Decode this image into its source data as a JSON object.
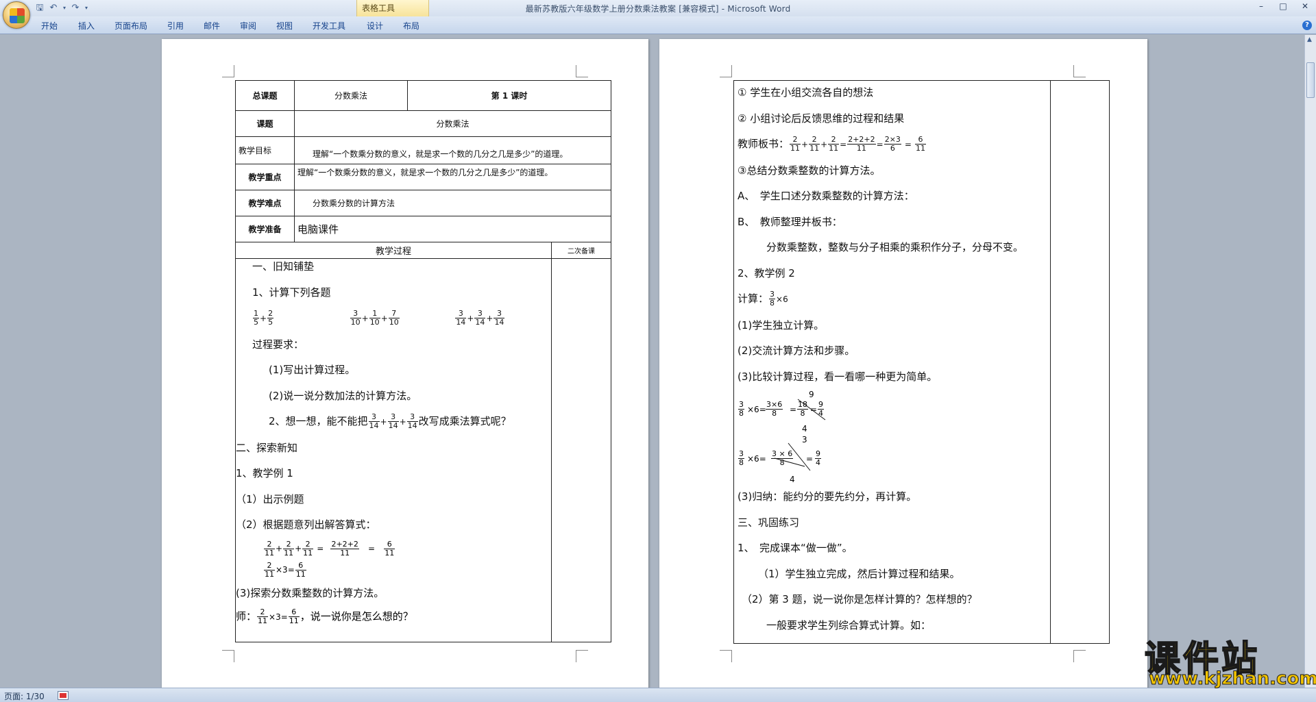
{
  "window": {
    "title": "最新苏教版六年级数学上册分数乘法教案 [兼容模式] - Microsoft Word",
    "context_tab_group": "表格工具"
  },
  "ribbon": {
    "tabs": [
      "开始",
      "插入",
      "页面布局",
      "引用",
      "邮件",
      "审阅",
      "视图",
      "开发工具",
      "设计",
      "布局"
    ]
  },
  "status": {
    "page": "页面: 1/30"
  },
  "left_page": {
    "header": {
      "general_topic_label": "总课题",
      "general_topic": "分数乘法",
      "period": "第 1 课时",
      "topic_label": "课题",
      "topic": "分数乘法",
      "goal_label": "教学目标",
      "goal": "理解“一个数乘分数的意义，就是求一个数的几分之几是多少”的道理。",
      "key_label": "教学重点",
      "key": "理解“一个数乘分数的意义，就是求一个数的几分之几是多少”的道理。",
      "difficulty_label": "教学难点",
      "difficulty": "分数乘分数的计算方法",
      "prep_label": "教学准备",
      "prep": "电脑课件",
      "process_label": "教学过程",
      "notes_label": "二次备课"
    },
    "body": {
      "l1": "一、旧知铺垫",
      "l2": "1、计算下列各题",
      "l3": "过程要求：",
      "l4": "(1)写出计算过程。",
      "l5": "(2)说一说分数加法的计算方法。",
      "l6a": "2、想一想，能不能把",
      "l6b": "改写成乘法算式呢？",
      "l7": "二、探索新知",
      "l8": "1、教学例 1",
      "l9": "（1）出示例题",
      "l10": "（2）根据题意列出解答算式：",
      "l11": "(3)探索分数乘整数的计算方法。",
      "l12a": "师：",
      "l12b": "，说一说你是怎么想的？",
      "times3": "×3=",
      "plus": "+",
      "eq": "=",
      "f": {
        "1": "1",
        "2": "2",
        "3": "3",
        "5": "5",
        "6": "6",
        "7": "7",
        "10": "10",
        "11": "11",
        "14": "14",
        "222": "2+2+2"
      }
    }
  },
  "right_page": {
    "r1": "① 学生在小组交流各自的想法",
    "r2": "② 小组讨论后反馈思维的过程和结果",
    "r3": "教师板书：",
    "r4": "③总结分数乘整数的计算方法。",
    "r5": "A、　学生口述分数乘整数的计算方法：",
    "r6": "B、　教师整理并板书：",
    "r7": "分数乘整数，整数与分子相乘的乘积作分子，分母不变。",
    "r8": "2、教学例 2",
    "r9a": "计算：",
    "r9b": "×6",
    "r10": "(1)学生独立计算。",
    "r11": "(2)交流计算方法和步骤。",
    "r12": "(3)比较计算过程，看一看哪一种更为简单。",
    "r13": "(3)归纳：能约分的要先约分，再计算。",
    "r14": "三、巩固练习",
    "r15": "1、　完成课本“做一做”。",
    "r16": "（1）学生独立完成，然后计算过程和结果。",
    "r17": "（2）第 3 题，说一说你是怎样计算的？怎样想的？",
    "r18": "一般要求学生列综合算式计算。如：",
    "times6": "×6=",
    "eq": "=",
    "f": {
      "2": "2",
      "3": "3",
      "4": "4",
      "6": "6",
      "8": "8",
      "9": "9",
      "11": "11",
      "18": "18",
      "222": "2+2+2",
      "2x3": "2×3",
      "3x6": "3×6",
      "3x6s": "3 × 6"
    }
  },
  "watermark": {
    "cn": "课件站",
    "url": "www.kjzhan.com"
  }
}
